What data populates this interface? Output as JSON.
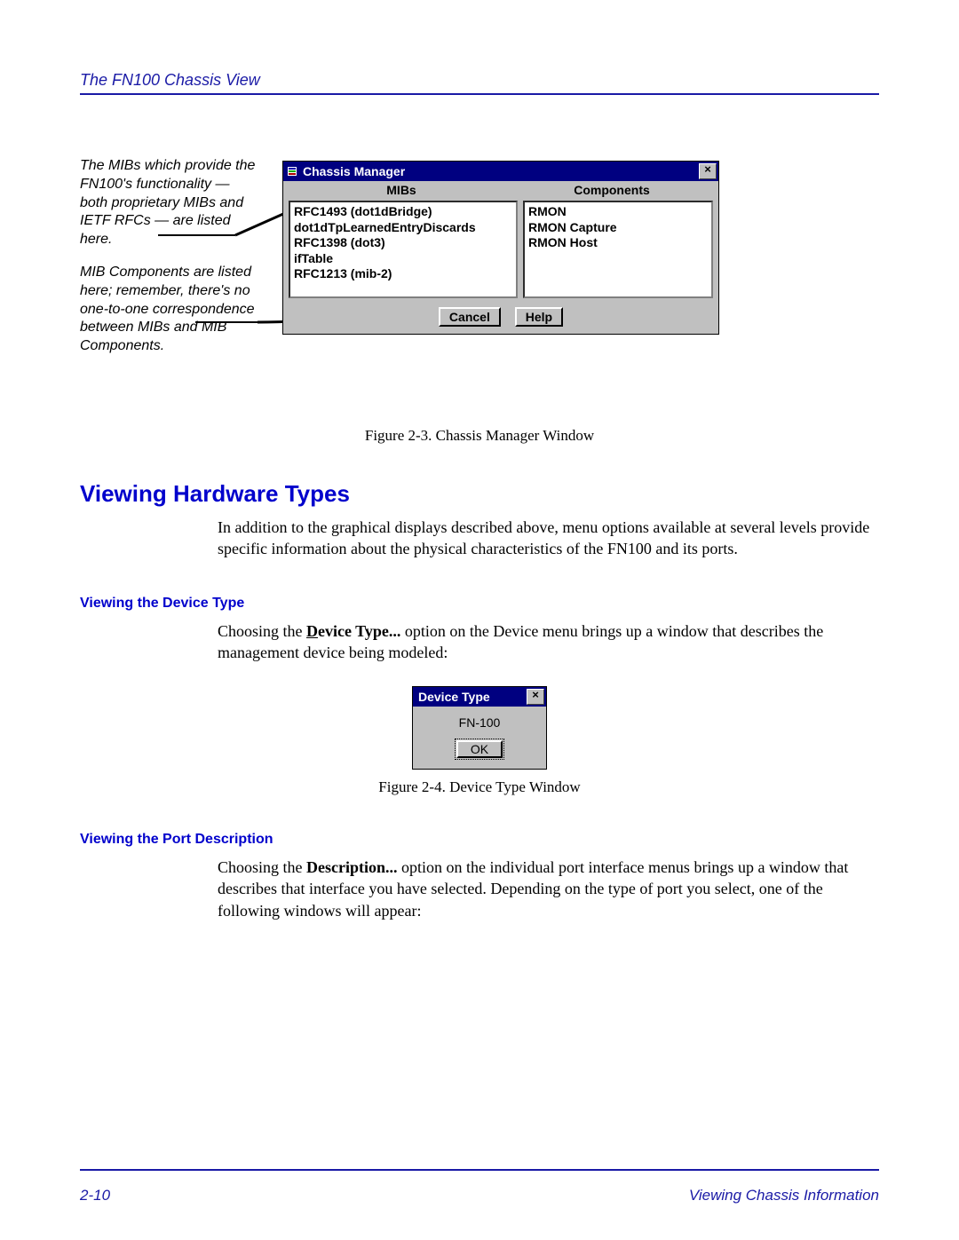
{
  "header": {
    "running_head": "The FN100 Chassis View"
  },
  "annotations": {
    "a1": "The MIBs which provide the FN100's functionality — both proprietary MIBs and IETF RFCs — are listed here.",
    "a2": "MIB Components are listed here; remember, there's no one-to-one correspondence between MIBs and MIB Components."
  },
  "chassis_window": {
    "title": "Chassis Manager",
    "close_x": "×",
    "col_mibs": "MIBs",
    "col_components": "Components",
    "mibs": [
      "RFC1493 (dot1dBridge)",
      "dot1dTpLearnedEntryDiscards",
      "RFC1398 (dot3)",
      "ifTable",
      "RFC1213 (mib-2)"
    ],
    "components": [
      "RMON",
      "RMON Capture",
      "RMON Host"
    ],
    "cancel": "Cancel",
    "help": "Help"
  },
  "fig1_caption": "Figure 2-3. Chassis Manager Window",
  "section1": {
    "heading": "Viewing Hardware Types",
    "para": "In addition to the graphical displays described above, menu options available at several levels provide specific information about the physical characteristics of the FN100 and its ports."
  },
  "section2": {
    "heading": "Viewing the Device Type",
    "para_pre": "Choosing the ",
    "menu_bold_u": "D",
    "menu_bold_rest": "evice Type...",
    "para_post": " option on the Device menu brings up a window that describes the management device being modeled:"
  },
  "device_window": {
    "title": "Device Type",
    "close_x": "×",
    "value": "FN-100",
    "ok": "OK"
  },
  "fig2_caption": "Figure 2-4. Device Type Window",
  "section3": {
    "heading": "Viewing the Port Description",
    "para_pre": "Choosing the ",
    "menu_bold": "Description...",
    "para_post": " option on the individual port interface menus brings up a window that describes that interface you have selected. Depending on the type of port you select, one of the following windows will appear:"
  },
  "footer": {
    "page": "2-10",
    "section": "Viewing Chassis Information"
  }
}
